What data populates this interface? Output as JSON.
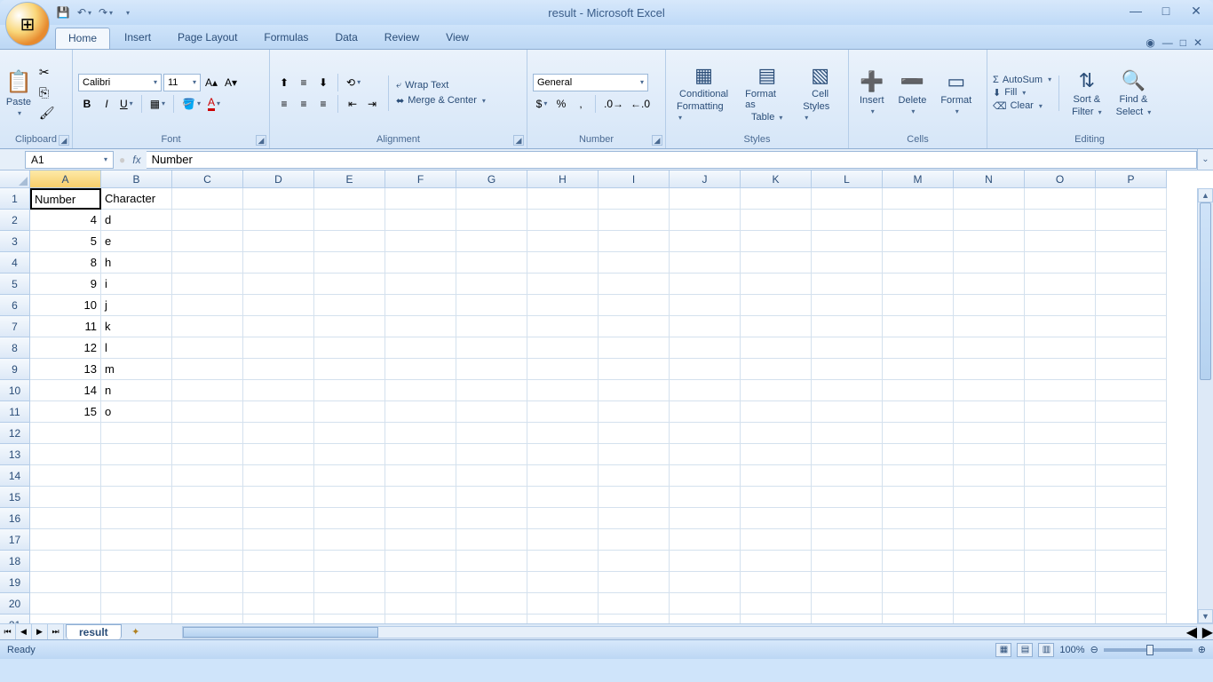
{
  "title": "result - Microsoft Excel",
  "tabs": [
    "Home",
    "Insert",
    "Page Layout",
    "Formulas",
    "Data",
    "Review",
    "View"
  ],
  "active_tab": 0,
  "clipboard": {
    "paste": "Paste",
    "label": "Clipboard"
  },
  "font": {
    "name": "Calibri",
    "size": "11",
    "label": "Font"
  },
  "alignment": {
    "wrap": "Wrap Text",
    "merge": "Merge & Center",
    "label": "Alignment"
  },
  "number": {
    "format": "General",
    "label": "Number"
  },
  "styles": {
    "cond": "Conditional",
    "cond2": "Formatting",
    "fmt": "Format as",
    "fmt2": "Table",
    "cell": "Cell",
    "cell2": "Styles",
    "label": "Styles"
  },
  "cells": {
    "insert": "Insert",
    "delete": "Delete",
    "format": "Format",
    "label": "Cells"
  },
  "editing": {
    "sum": "AutoSum",
    "fill": "Fill",
    "clear": "Clear",
    "sort": "Sort &",
    "sort2": "Filter",
    "find": "Find &",
    "find2": "Select",
    "label": "Editing"
  },
  "namebox": "A1",
  "formula": "Number",
  "columns": [
    "A",
    "B",
    "C",
    "D",
    "E",
    "F",
    "G",
    "H",
    "I",
    "J",
    "K",
    "L",
    "M",
    "N",
    "O",
    "P"
  ],
  "selected_col": "A",
  "rows": 21,
  "cells_data": {
    "1": {
      "A": "Number",
      "B": "Character"
    },
    "2": {
      "A": "4",
      "B": "d"
    },
    "3": {
      "A": "5",
      "B": "e"
    },
    "4": {
      "A": "8",
      "B": "h"
    },
    "5": {
      "A": "9",
      "B": "i"
    },
    "6": {
      "A": "10",
      "B": "j"
    },
    "7": {
      "A": "11",
      "B": "k"
    },
    "8": {
      "A": "12",
      "B": "l"
    },
    "9": {
      "A": "13",
      "B": "m"
    },
    "10": {
      "A": "14",
      "B": "n"
    },
    "11": {
      "A": "15",
      "B": "o"
    }
  },
  "selected_cell": "A1",
  "sheet_name": "result",
  "status": "Ready",
  "zoom": "100%"
}
